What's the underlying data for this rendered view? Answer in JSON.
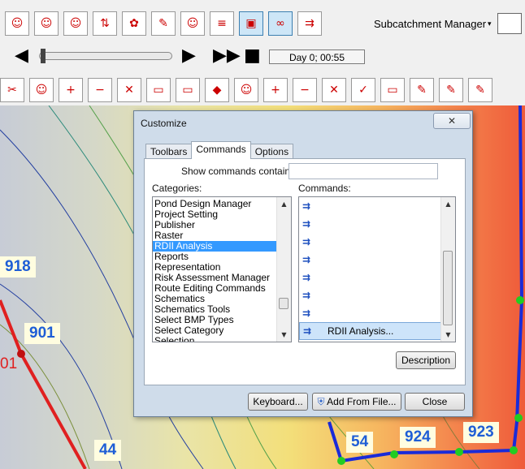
{
  "toolbar": {
    "dropdown_label": "Subcatchment Manager",
    "time_display": "Day 0;  00:55"
  },
  "map": {
    "labels": [
      "918",
      "901",
      "44",
      "54",
      "924",
      "923"
    ],
    "partial_label": "01"
  },
  "dialog": {
    "title": "Customize",
    "close": "✕",
    "tabs": [
      "Toolbars",
      "Commands",
      "Options"
    ],
    "active_tab": "Commands",
    "search_label": "Show commands containing:",
    "search_value": "",
    "categories_label": "Categories:",
    "commands_label": "Commands:",
    "categories": [
      "Pond Design Manager",
      "Project Setting",
      "Publisher",
      "Raster",
      "RDII Analysis",
      "Reports",
      "Representation",
      "Risk Assessment Manager",
      "Route Editing Commands",
      "Schematics",
      "Schematics Tools",
      "Select BMP Types",
      "Select Category",
      "Selection"
    ],
    "selected_category": "RDII Analysis",
    "command_selected_label": "RDII Analysis...",
    "buttons": {
      "description": "Description",
      "keyboard": "Keyboard...",
      "add_from_file": "Add From File...",
      "close": "Close"
    }
  },
  "colors": {
    "selection": "#3399ff",
    "label_text": "#1e5ed6",
    "pipe_red": "#e02020",
    "pipe_blue": "#1a2bd8"
  }
}
